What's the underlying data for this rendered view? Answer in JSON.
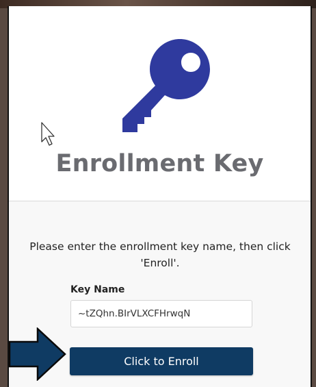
{
  "page": {
    "title": "Enrollment Key"
  },
  "form": {
    "instructions": "Please enter the enrollment key name, then click 'Enroll'.",
    "key_name_label": "Key Name",
    "key_name_value": "~tZQhn.BIrVLXCFHrwqN",
    "enroll_button_label": "Click to Enroll"
  },
  "icons": {
    "hero": "key-icon",
    "pointer": "mouse-cursor-icon",
    "callout": "arrow-right-icon"
  },
  "colors": {
    "key_icon": "#2f3a9e",
    "title_text": "#6a6b70",
    "button_bg": "#0f3b63",
    "button_text": "#ffffff",
    "arrow_fill": "#0f3b63"
  }
}
